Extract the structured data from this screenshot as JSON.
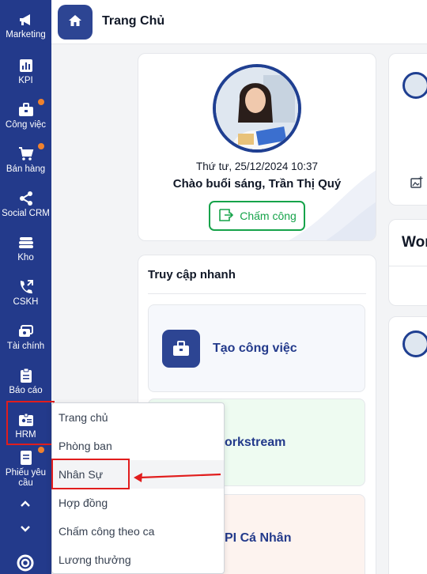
{
  "sidebar": {
    "items": [
      {
        "label": "Marketing",
        "icon": "megaphone-icon",
        "badge": false
      },
      {
        "label": "KPI",
        "icon": "bar-chart-icon",
        "badge": false
      },
      {
        "label": "Công việc",
        "icon": "briefcase-icon",
        "badge": true
      },
      {
        "label": "Bán hàng",
        "icon": "cart-icon",
        "badge": true
      },
      {
        "label": "Social CRM",
        "icon": "share-icon",
        "badge": false
      },
      {
        "label": "Kho",
        "icon": "warehouse-icon",
        "badge": false
      },
      {
        "label": "CSKH",
        "icon": "phone-icon",
        "badge": false
      },
      {
        "label": "Tài chính",
        "icon": "money-icon",
        "badge": false
      },
      {
        "label": "Báo cáo",
        "icon": "clipboard-icon",
        "badge": false
      },
      {
        "label": "HRM",
        "icon": "id-card-icon",
        "badge": false
      },
      {
        "label": "Phiếu yêu cầu",
        "icon": "document-icon",
        "badge": true
      }
    ],
    "badge_color": "#f0822e",
    "bg_color": "#233a8b"
  },
  "header": {
    "title": "Trang Chủ"
  },
  "profile": {
    "datetime": "Thứ tư, 25/12/2024 10:37",
    "greeting": "Chào buổi sáng, Trần Thị Quý",
    "checkin_label": "Chấm công"
  },
  "quick_access": {
    "title": "Truy cập nhanh",
    "tiles": [
      {
        "label": "Tạo công việc"
      },
      {
        "label": "orkstream"
      },
      {
        "label": "PI Cá Nhân"
      }
    ]
  },
  "right_panel": {
    "partial_title": "Wor"
  },
  "hrm_menu": {
    "items": [
      "Trang chủ",
      "Phòng ban",
      "Nhân Sự",
      "Hợp đồng",
      "Chấm công theo ca",
      "Lương thưởng"
    ],
    "active": "Nhân Sự"
  },
  "colors": {
    "accent": "#233a8b",
    "highlight": "#e11d1d",
    "success": "#16a34a"
  }
}
